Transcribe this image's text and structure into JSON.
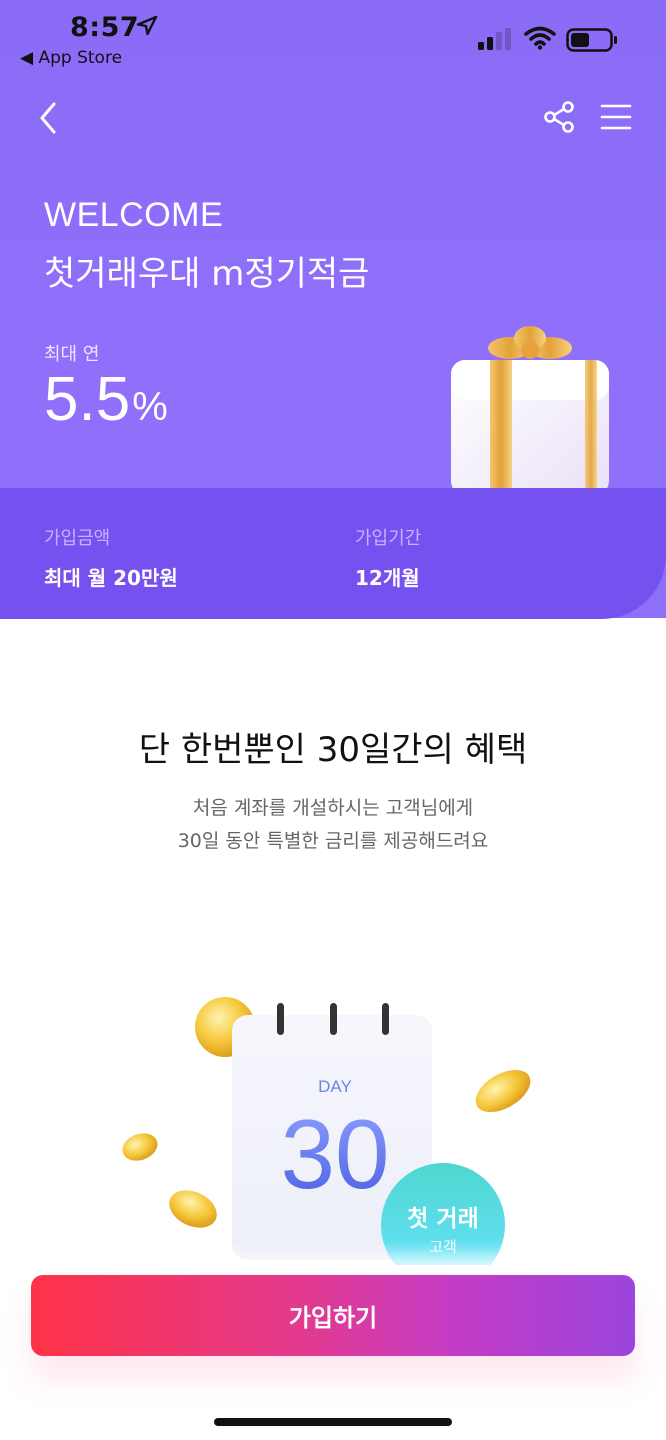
{
  "status_bar": {
    "time": "8:57",
    "back_app": "◀ App Store"
  },
  "nav": {
    "back_icon": "chevron-left-icon",
    "share_icon": "share-icon",
    "menu_icon": "hamburger-menu-icon"
  },
  "hero": {
    "welcome": "WELCOME",
    "product_name": "첫거래우대 m정기적금",
    "rate_label": "최대 연",
    "rate_value": "5.5",
    "rate_unit": "%"
  },
  "info": {
    "amount_label": "가입금액",
    "amount_value": "최대 월 20만원",
    "period_label": "가입기간",
    "period_value": "12개월"
  },
  "benefit": {
    "title": "단 한번뿐인 30일간의 혜택",
    "desc_line1": "처음 계좌를 개설하시는 고객님에게",
    "desc_line2": "30일 동안 특별한 금리를 제공해드려요"
  },
  "illustration": {
    "day_label": "DAY",
    "day_number": "30",
    "badge_title": "첫 거래",
    "badge_sub": "고객"
  },
  "cta": {
    "label": "가입하기"
  },
  "colors": {
    "hero_bg": "#8b6cf6",
    "band_bg": "#7552ef",
    "cta_start": "#ff3347",
    "cta_end": "#9b45dc"
  }
}
